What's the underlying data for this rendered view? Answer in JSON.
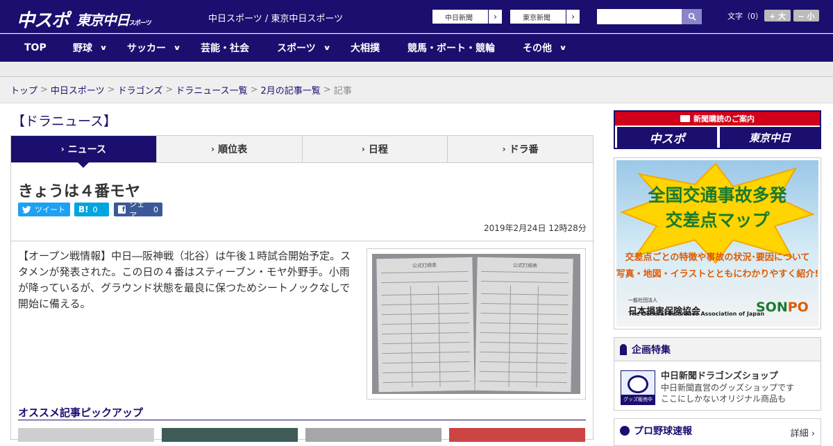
{
  "header": {
    "logo_main": "中スポ",
    "logo_tokyo": "東京中日",
    "logo_tokyo_small": "スポーツ",
    "site_title": "中日スポーツ / 東京中日スポーツ",
    "paper_links": [
      {
        "label": "中日新聞"
      },
      {
        "label": "東京新聞"
      }
    ],
    "search_placeholder": "",
    "font_size_label": "文字（0）",
    "font_larger": "+ 大",
    "font_smaller": "− 小"
  },
  "nav": [
    {
      "label": "TOP",
      "has_dropdown": false
    },
    {
      "label": "野球",
      "has_dropdown": true
    },
    {
      "label": "サッカー",
      "has_dropdown": true
    },
    {
      "label": "芸能・社会",
      "has_dropdown": false
    },
    {
      "label": "スポーツ",
      "has_dropdown": true
    },
    {
      "label": "大相撲",
      "has_dropdown": false
    },
    {
      "label": "競馬・ボート・競輪",
      "has_dropdown": false
    },
    {
      "label": "その他",
      "has_dropdown": true
    }
  ],
  "breadcrumb": {
    "items": [
      "トップ",
      "中日スポーツ",
      "ドラゴンズ",
      "ドラニュース一覧",
      "2月の記事一覧"
    ],
    "separator": ">",
    "current": "記事"
  },
  "section_title": "【ドラニュース】",
  "tabs": [
    {
      "label": "ニュース",
      "active": true
    },
    {
      "label": "順位表",
      "active": false
    },
    {
      "label": "日程",
      "active": false
    },
    {
      "label": "ドラ番",
      "active": false
    }
  ],
  "article": {
    "headline": "きょうは４番モヤ",
    "share": {
      "tweet": "ツイート",
      "hatena_label": "B!",
      "hatena_count": "0",
      "facebook": "シェア",
      "facebook_count": "0"
    },
    "date": "2019年2月24日 12時28分",
    "body": "【オープン戦情報】中日―阪神戦（北谷）は午後１時試合開始予定。スタメンが発表された。この日の４番はスティーブン・モヤ外野手。小雨が降っているが、グラウンド状態を最良に保つためシートノックなしで開始に備える。",
    "photo": {
      "left_sheet_header": "公式打順表",
      "right_sheet_header": "公式打順表"
    }
  },
  "pickup": {
    "title": "オススメ記事ピックアップ"
  },
  "sidebar": {
    "subscription": {
      "heading": "新聞購読のご案内",
      "logo_a": "中スポ",
      "logo_b": "東京中日"
    },
    "ad": {
      "title_line1": "全国交通事故多発",
      "title_line2": "交差点マップ",
      "sub_line1": "交差点ごとの特徴や事故の状況･要因について",
      "sub_line2": "写真・地図・イラストとともにわかりやすく紹介!",
      "org_small": "一般社団法人",
      "org": "日本損害保険協会",
      "org_en": "The General Insurance Association of Japan",
      "brand_a": "SON",
      "brand_b": "PO"
    },
    "special": {
      "heading": "企画特集",
      "shop_badge": "グッズ販売中",
      "shop_title": "中日新聞ドラゴンズショップ",
      "shop_desc_1": "中日新聞直営のグッズショップです",
      "shop_desc_2": "ここにしかないオリジナル商品も"
    },
    "live": {
      "heading": "プロ野球速報",
      "detail": "詳細 ›"
    }
  },
  "colors": {
    "brand_navy": "#1a0e6e",
    "tweet": "#1da1f2",
    "hatena": "#00a4de",
    "facebook": "#3b5998",
    "subscription_red": "#d0021b"
  }
}
